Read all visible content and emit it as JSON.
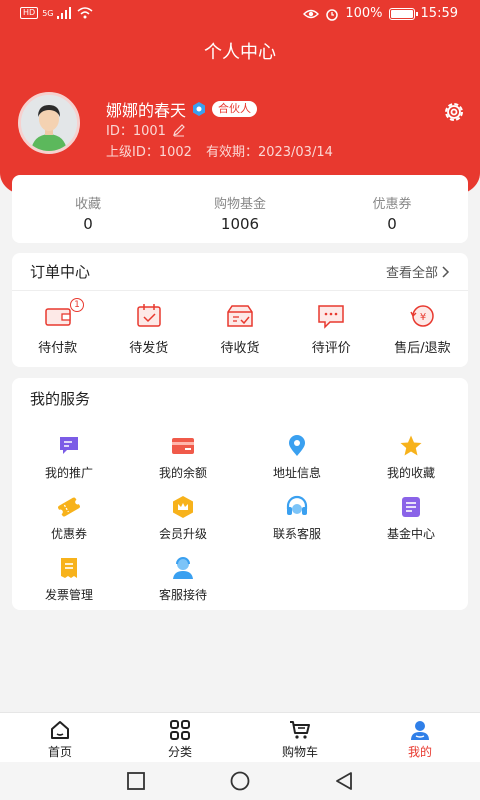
{
  "status_bar": {
    "left_chip": "HD",
    "network": "5G",
    "battery": "100%",
    "time": "15:59"
  },
  "header": {
    "title": "个人中心"
  },
  "profile": {
    "username": "娜娜的春天",
    "badge": "合伙人",
    "id_text": "ID：1001",
    "superior": "上级ID：1002",
    "expiry": "有效期：2023/03/14"
  },
  "stats": [
    {
      "label": "收藏",
      "value": "0"
    },
    {
      "label": "购物基金",
      "value": "1006"
    },
    {
      "label": "优惠券",
      "value": "0"
    }
  ],
  "orders": {
    "title": "订单中心",
    "view_all": "查看全部",
    "items": [
      {
        "label": "待付款",
        "icon": "wallet-icon",
        "badge": "1"
      },
      {
        "label": "待发货",
        "icon": "calendar-check-icon"
      },
      {
        "label": "待收货",
        "icon": "box-icon"
      },
      {
        "label": "待评价",
        "icon": "comment-icon"
      },
      {
        "label": "售后/退款",
        "icon": "refund-icon"
      }
    ]
  },
  "services": {
    "title": "我的服务",
    "items": [
      {
        "label": "我的推广",
        "icon": "chat-icon"
      },
      {
        "label": "我的余额",
        "icon": "card-icon"
      },
      {
        "label": "地址信息",
        "icon": "location-icon"
      },
      {
        "label": "我的收藏",
        "icon": "star-icon"
      },
      {
        "label": "优惠券",
        "icon": "ticket-icon"
      },
      {
        "label": "会员升级",
        "icon": "crown-icon"
      },
      {
        "label": "联系客服",
        "icon": "headset-icon"
      },
      {
        "label": "基金中心",
        "icon": "fund-doc-icon"
      },
      {
        "label": "发票管理",
        "icon": "invoice-icon"
      },
      {
        "label": "客服接待",
        "icon": "agent-icon"
      }
    ]
  },
  "nav": {
    "items": [
      {
        "label": "首页",
        "icon": "home-icon"
      },
      {
        "label": "分类",
        "icon": "grid-icon"
      },
      {
        "label": "购物车",
        "icon": "cart-icon"
      },
      {
        "label": "我的",
        "icon": "user-icon",
        "active": true
      }
    ]
  },
  "colors": {
    "brand": "#e8392f",
    "background": "#f3f3f3"
  }
}
